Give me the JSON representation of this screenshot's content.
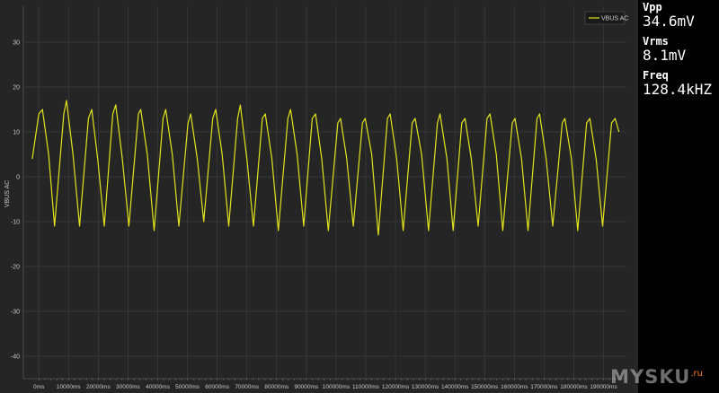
{
  "chart_data": {
    "type": "line",
    "title": "",
    "xlabel": "",
    "ylabel": "VBUS AC",
    "xlim": [
      -5200,
      197700
    ],
    "ylim": [
      -45,
      38
    ],
    "grid": true,
    "legend_position": "top-right",
    "x_ticks": [
      0,
      10000,
      20000,
      30000,
      40000,
      50000,
      60000,
      70000,
      80000,
      90000,
      100000,
      110000,
      120000,
      130000,
      140000,
      150000,
      160000,
      170000,
      180000,
      190000
    ],
    "x_tick_labels": [
      "0ms",
      "10000ms",
      "20000ms",
      "30000ms",
      "40000ms",
      "50000ms",
      "60000ms",
      "70000ms",
      "80000ms",
      "90000ms",
      "100000ms",
      "110000ms",
      "120000ms",
      "130000ms",
      "140000ms",
      "150000ms",
      "160000ms",
      "170000ms",
      "180000ms",
      "190000ms"
    ],
    "y_ticks": [
      30,
      20,
      10,
      0,
      -10,
      -20,
      -30,
      -40
    ],
    "y_tick_labels": [
      "30",
      "20",
      "10",
      "0",
      "-10",
      "-20",
      "-30",
      "-40"
    ],
    "series": [
      {
        "name": "VBUS AC",
        "color": "#e3e31c",
        "x": [
          -2200,
          0,
          1200,
          3300,
          5300,
          8400,
          9300,
          11500,
          13700,
          16700,
          17800,
          19800,
          22000,
          24900,
          25900,
          28100,
          30300,
          33500,
          34300,
          36500,
          38800,
          41800,
          42700,
          44900,
          47100,
          50200,
          51100,
          53300,
          55500,
          58500,
          59500,
          61700,
          63900,
          66900,
          67800,
          70000,
          72200,
          75200,
          76200,
          78400,
          80600,
          83800,
          84700,
          86900,
          89100,
          92000,
          93100,
          95200,
          97400,
          100600,
          101500,
          103600,
          105800,
          108900,
          109800,
          112000,
          114200,
          117300,
          118200,
          120400,
          122600,
          125600,
          126600,
          128800,
          131100,
          134100,
          135000,
          137300,
          139400,
          142300,
          143400,
          145500,
          147800,
          150800,
          151800,
          153900,
          156100,
          159300,
          160200,
          162400,
          164600,
          167600,
          168500,
          170700,
          172900,
          176100,
          177000,
          179200,
          181300,
          184300,
          185400,
          187500,
          189700,
          192700,
          193900,
          195200
        ],
        "y": [
          4,
          14,
          15,
          5,
          -11,
          14,
          17,
          5,
          -11,
          13,
          15,
          4,
          -11,
          14,
          16,
          4,
          -11,
          14,
          15,
          5,
          -12,
          13,
          15,
          5,
          -11,
          12,
          14,
          4,
          -10,
          13,
          15,
          5,
          -11,
          13,
          16,
          4,
          -11,
          13,
          14,
          4,
          -12,
          13,
          15,
          5,
          -11,
          13,
          14,
          4,
          -12,
          12,
          13,
          4,
          -11,
          12,
          13,
          5,
          -13,
          13,
          14,
          4,
          -12,
          12,
          13,
          5,
          -12,
          12,
          14,
          4,
          -12,
          12,
          13,
          4,
          -11,
          13,
          14,
          5,
          -12,
          12,
          13,
          4,
          -12,
          13,
          14,
          4,
          -11,
          12,
          13,
          4,
          -12,
          12,
          13,
          4,
          -11,
          12,
          13,
          10
        ]
      }
    ]
  },
  "readouts": {
    "vpp": {
      "label": "Vpp",
      "value": "34.6mV"
    },
    "vrms": {
      "label": "Vrms",
      "value": "8.1mV"
    },
    "freq": {
      "label": "Freq",
      "value": "128.4kHZ"
    }
  },
  "watermark": {
    "text": "MYSKU",
    "suffix": ".ru"
  },
  "colors": {
    "plot_background": "#252525",
    "grid": "#3d3d3d",
    "tick_label": "#c8c8c8",
    "trace": "#e3e31c"
  }
}
